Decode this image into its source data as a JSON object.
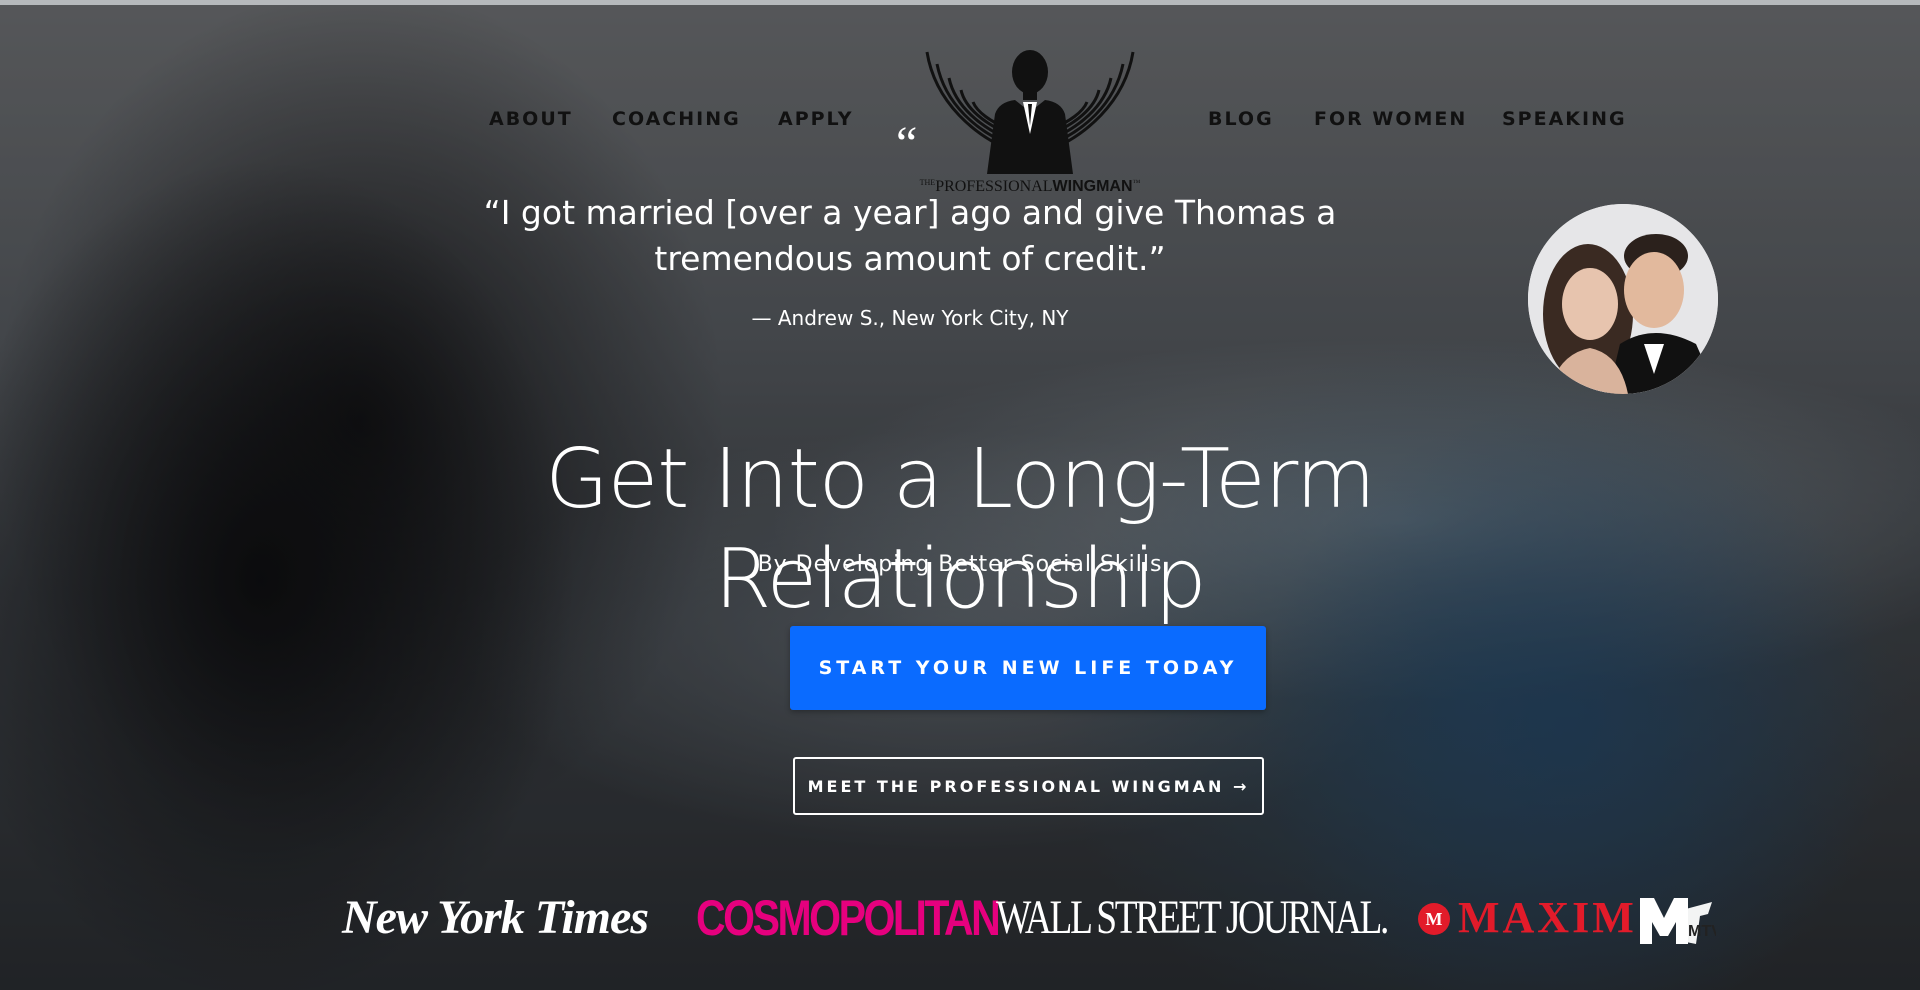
{
  "nav": {
    "left": [
      {
        "label": "ABOUT"
      },
      {
        "label": "COACHING"
      },
      {
        "label": "APPLY"
      }
    ],
    "right": [
      {
        "label": "BLOG"
      },
      {
        "label": "FOR WOMEN"
      },
      {
        "label": "SPEAKING"
      }
    ]
  },
  "logo": {
    "prefix_small": "THE",
    "word1": "PROFESSIONAL",
    "word2": "WINGMAN",
    "tm": "™",
    "icon": "winged-man-icon"
  },
  "testimonial": {
    "quote_mark": "“",
    "quote": "“I got married [over a year] ago and give Thomas a tremendous amount of credit.”",
    "attribution": "— Andrew S., New York City, NY"
  },
  "hero": {
    "headline": "Get Into a Long-Term Relationship",
    "subheadline": "By Developing Better Social Skills"
  },
  "cta": {
    "primary_label": "START YOUR NEW LIFE TODAY",
    "secondary_label": "MEET THE PROFESSIONAL WINGMAN →",
    "primary_color": "#0a6bff"
  },
  "press": {
    "nyt": "New York Times",
    "cosmo": "COSMOPOLITAN",
    "wsj": "WALL STREET JOURNAL.",
    "maxim_badge": "M",
    "maxim": "MAXIM",
    "mtv": "MTV"
  },
  "colors": {
    "cosmo": "#e6007e",
    "maxim": "#e21b2a"
  }
}
